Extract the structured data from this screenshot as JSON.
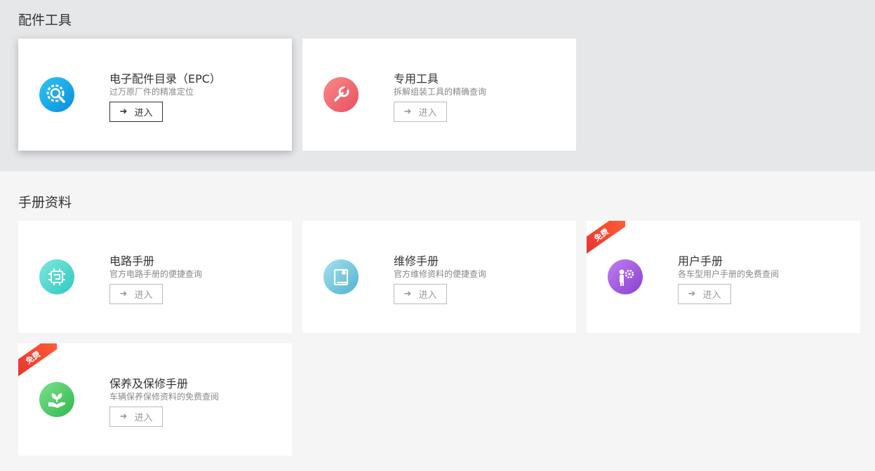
{
  "sections": [
    {
      "title": "配件工具"
    },
    {
      "title": "手册资料"
    }
  ],
  "cards": [
    {
      "title": "电子配件目录（EPC）",
      "desc": "过万原厂件的精准定位",
      "enter": "进入",
      "arrow": "➜",
      "icon": "gear-search-icon",
      "color": "#1aa3e8"
    },
    {
      "title": "专用工具",
      "desc": "拆解组装工具的精确查询",
      "enter": "进入",
      "arrow": "➜",
      "icon": "wrench-icon",
      "color": "#ef5b6a"
    },
    {
      "title": "电路手册",
      "desc": "官方电路手册的便捷查询",
      "enter": "进入",
      "arrow": "➜",
      "icon": "circuit-icon",
      "color": "#3fd3c4"
    },
    {
      "title": "维修手册",
      "desc": "官方维修资料的便捷查询",
      "enter": "进入",
      "arrow": "➜",
      "icon": "manual-book-icon",
      "color": "#5bbad5"
    },
    {
      "title": "用户手册",
      "desc": "各车型用户手册的免费查阅",
      "enter": "进入",
      "arrow": "➜",
      "icon": "user-gear-icon",
      "color": "#a056d8",
      "badge": "免费"
    },
    {
      "title": "保养及保修手册",
      "desc": "车辆保养保修资料的免费查阅",
      "enter": "进入",
      "arrow": "➜",
      "icon": "hand-leaf-icon",
      "color": "#3fc45a",
      "badge": "免费"
    }
  ]
}
